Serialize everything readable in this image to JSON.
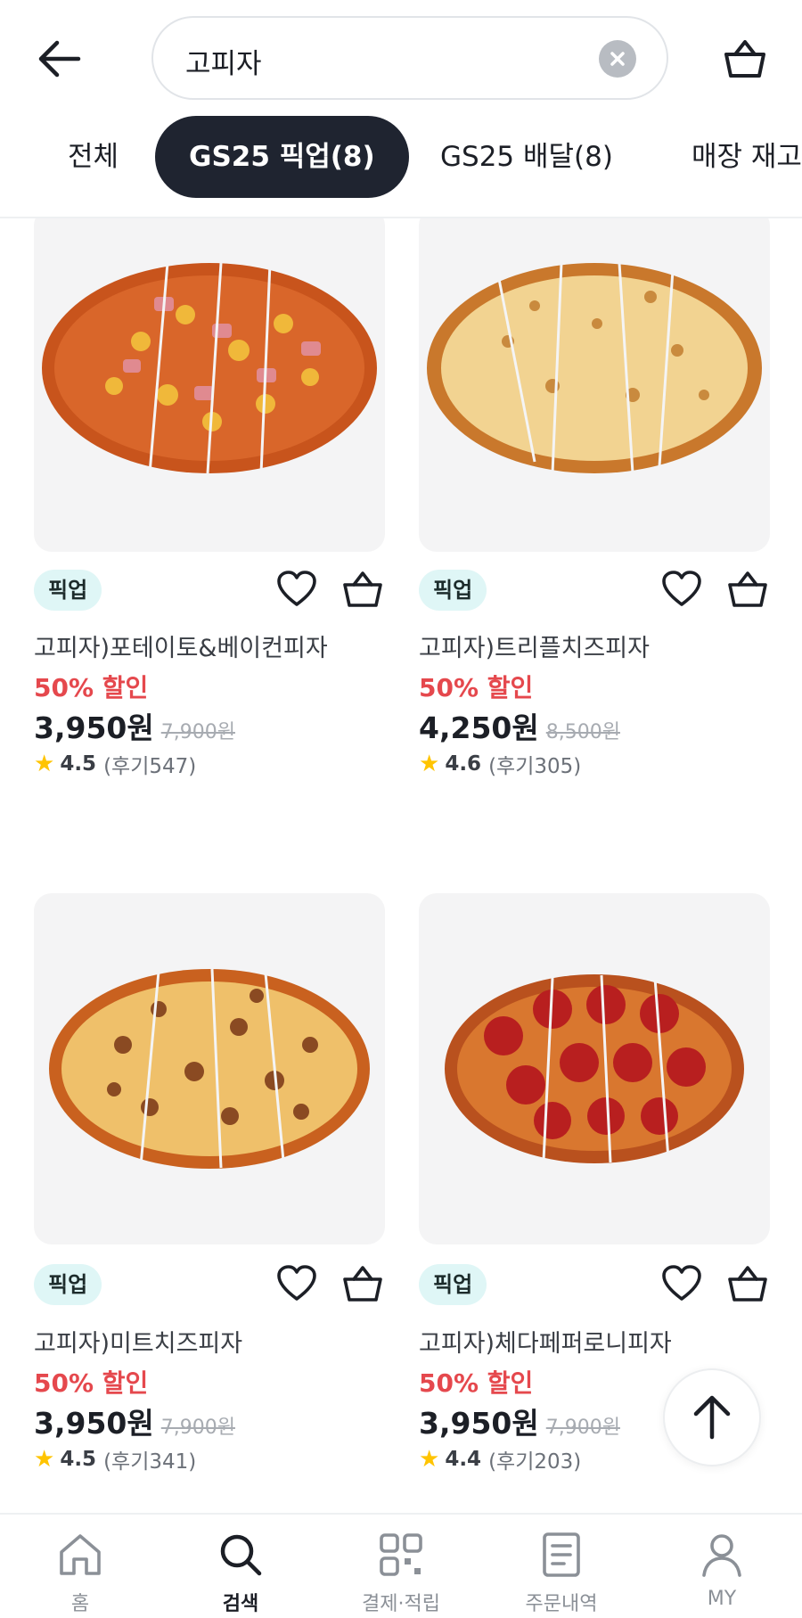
{
  "search": {
    "query": "고피자"
  },
  "tabs": [
    {
      "label": "전체"
    },
    {
      "label": "GS25 픽업(8)"
    },
    {
      "label": "GS25 배달(8)"
    },
    {
      "label": "매장 재고"
    }
  ],
  "products": [
    {
      "badge": "픽업",
      "name": "고피자)포테이토&베이컨피자",
      "discount": "50% 할인",
      "price": "3,950원",
      "original_price": "7,900원",
      "rating": "4.5",
      "reviews": "(후기547)",
      "image": "potato-bacon-pizza"
    },
    {
      "badge": "픽업",
      "name": "고피자)트리플치즈피자",
      "discount": "50% 할인",
      "price": "4,250원",
      "original_price": "8,500원",
      "rating": "4.6",
      "reviews": "(후기305)",
      "image": "triple-cheese-pizza"
    },
    {
      "badge": "픽업",
      "name": "고피자)미트치즈피자",
      "discount": "50% 할인",
      "price": "3,950원",
      "original_price": "7,900원",
      "rating": "4.5",
      "reviews": "(후기341)",
      "image": "meat-cheese-pizza"
    },
    {
      "badge": "픽업",
      "name": "고피자)체다페퍼로니피자",
      "discount": "50% 할인",
      "price": "3,950원",
      "original_price": "7,900원",
      "rating": "4.4",
      "reviews": "(후기203)",
      "image": "cheddar-pepperoni-pizza"
    }
  ],
  "bottom_nav": [
    {
      "label": "홈",
      "icon": "home-icon"
    },
    {
      "label": "검색",
      "icon": "search-icon"
    },
    {
      "label": "결제·적립",
      "icon": "qr-icon"
    },
    {
      "label": "주문내역",
      "icon": "receipt-icon"
    },
    {
      "label": "MY",
      "icon": "profile-icon"
    }
  ],
  "colors": {
    "accent_dark": "#1f2430",
    "discount_red": "#e5484d",
    "badge_bg": "#dff6f6",
    "star": "#ffc400"
  }
}
